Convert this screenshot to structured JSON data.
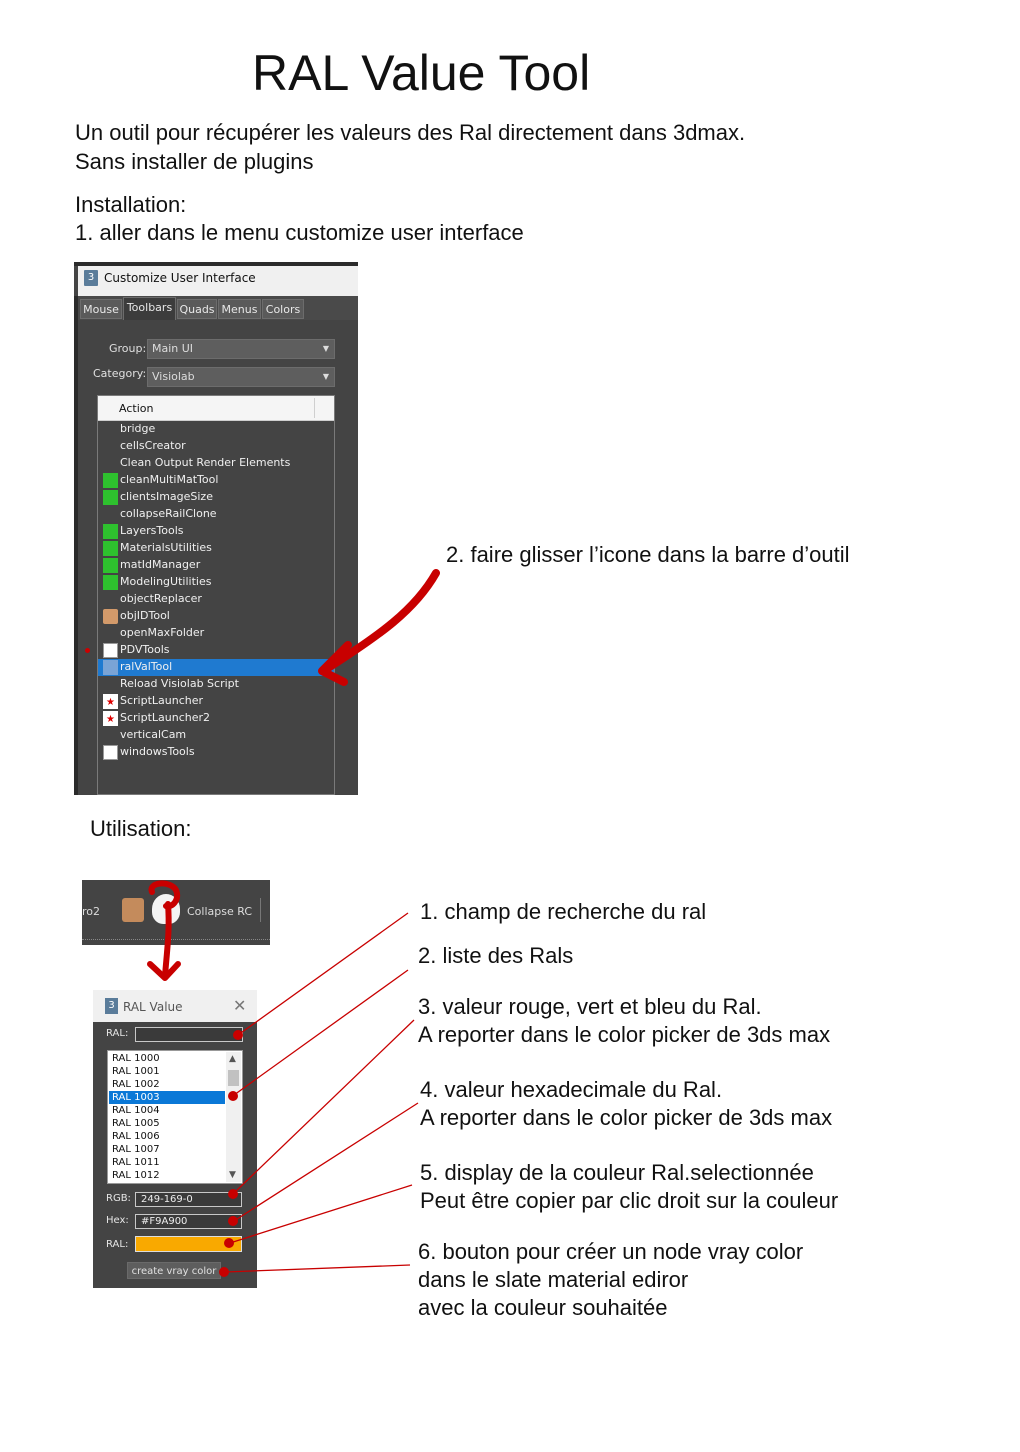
{
  "title": "RAL Value Tool",
  "intro": {
    "line1": "Un outil pour récupérer les valeurs des Ral directement dans 3dmax.",
    "line2": "Sans installer de plugins"
  },
  "installation": {
    "heading": "Installation:",
    "step1": "1. aller dans le menu customize user interface",
    "step2": "2. faire glisser l’icone  dans la barre d’outil"
  },
  "customize_window": {
    "app_icon": "3",
    "title": "Customize User Interface",
    "tabs": [
      "Mouse",
      "Toolbars",
      "Quads",
      "Menus",
      "Colors"
    ],
    "active_tab": "Toolbars",
    "group_label": "Group:",
    "group_value": "Main UI",
    "category_label": "Category:",
    "category_value": "Visiolab",
    "list_header": "Action",
    "actions": [
      {
        "label": "bridge",
        "icon": ""
      },
      {
        "label": "cellsCreator",
        "icon": ""
      },
      {
        "label": "Clean Output Render Elements",
        "icon": ""
      },
      {
        "label": "cleanMultiMatTool",
        "icon": "CLEAN MULTI"
      },
      {
        "label": "clientsImageSize",
        "icon": "SIZE"
      },
      {
        "label": "collapseRailClone",
        "icon": ""
      },
      {
        "label": "LayersTools",
        "icon": "LAY"
      },
      {
        "label": "MaterialsUtilities",
        "icon": "MAT"
      },
      {
        "label": "matIdManager",
        "icon": "ID"
      },
      {
        "label": "ModelingUtilities",
        "icon": "MOD"
      },
      {
        "label": "objectReplacer",
        "icon": ""
      },
      {
        "label": "objIDTool",
        "icon": "face"
      },
      {
        "label": "openMaxFolder",
        "icon": ""
      },
      {
        "label": "PDVTools",
        "icon": "PDV"
      },
      {
        "label": "ralValTool",
        "icon": "ral"
      },
      {
        "label": "Reload Visiolab Script",
        "icon": ""
      },
      {
        "label": "ScriptLauncher",
        "icon": "MXS"
      },
      {
        "label": "ScriptLauncher2",
        "icon": "MXS"
      },
      {
        "label": "verticalCam",
        "icon": ""
      },
      {
        "label": "windowsTools",
        "icon": "Win"
      }
    ],
    "selected_action": "ralValTool"
  },
  "utilisation": {
    "heading": "Utilisation:"
  },
  "toolbar": {
    "left_text": "ro2",
    "right_text": "Collapse RC"
  },
  "ral_dialog": {
    "app_icon": "3",
    "title": "RAL Value",
    "close": "✕",
    "search_label": "RAL:",
    "search_value": "",
    "list": [
      "RAL 1000",
      "RAL 1001",
      "RAL 1002",
      "RAL 1003",
      "RAL 1004",
      "RAL 1005",
      "RAL 1006",
      "RAL 1007",
      "RAL 1011",
      "RAL 1012"
    ],
    "selected": "RAL 1003",
    "rgb_label": "RGB:",
    "rgb_value": "249-169-0",
    "hex_label": "Hex:",
    "hex_value": "#F9A900",
    "color_label": "RAL:",
    "color": "#F9A900",
    "button_label": "create vray color"
  },
  "annotations": {
    "a1": "1. champ de recherche du ral",
    "a2": "2. liste des Rals",
    "a3_line1": "3. valeur rouge, vert et bleu du Ral.",
    "a3_line2": "A reporter dans le color picker de 3ds max",
    "a4_line1": "4. valeur hexadecimale du Ral.",
    "a4_line2": "A reporter dans le color picker de 3ds max",
    "a5_line1": "5. display de la couleur Ral.selectionnée",
    "a5_line2": "Peut être copier par clic droit sur la couleur",
    "a6_line1": "6. bouton pour créer un node vray color",
    "a6_line2": "dans le slate material ediror",
    "a6_line3": "avec la couleur souhaitée"
  },
  "colors": {
    "accent_red": "#C80000",
    "selection_blue": "#1F7AD0",
    "ral_swatch": "#F9A900"
  }
}
